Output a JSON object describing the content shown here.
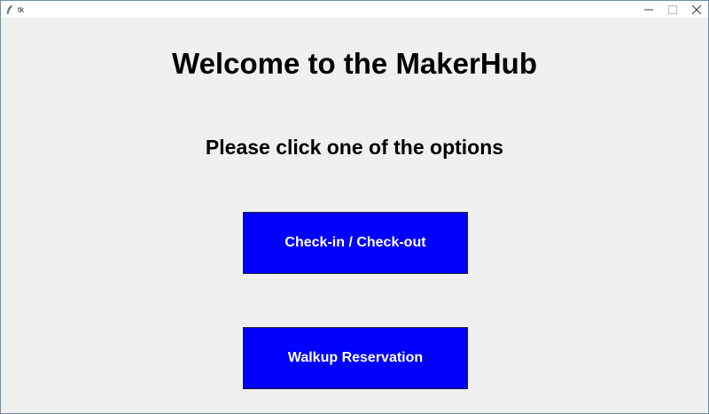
{
  "window": {
    "title": "tk",
    "icons": {
      "app": "feather-icon",
      "minimize": "minimize-icon",
      "maximize": "maximize-icon",
      "close": "close-icon"
    }
  },
  "main": {
    "heading": "Welcome to the MakerHub",
    "subheading": "Please click one of the options",
    "buttons": [
      {
        "label": "Check-in / Check-out"
      },
      {
        "label": "Walkup Reservation"
      }
    ]
  },
  "colors": {
    "background": "#f0f0f0",
    "button_bg": "#0000ff",
    "button_text": "#ffffff",
    "heading_text": "#000000"
  }
}
